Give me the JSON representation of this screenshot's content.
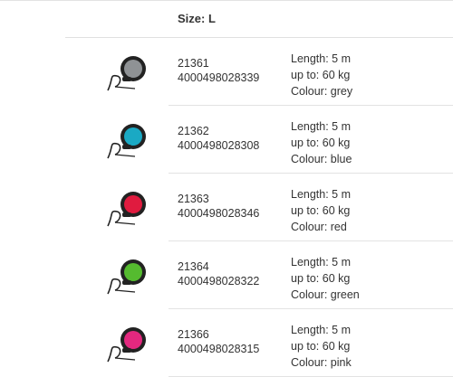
{
  "header": {
    "size_label": "Size: L"
  },
  "products": [
    {
      "article": "21361",
      "ean": "4000498028339",
      "length": "Length: 5 m",
      "weight": "up to: 60 kg",
      "colour_text": "Colour: grey",
      "color": "#8f9295"
    },
    {
      "article": "21362",
      "ean": "4000498028308",
      "length": "Length: 5 m",
      "weight": "up to: 60 kg",
      "colour_text": "Colour: blue",
      "color": "#1aa9c4"
    },
    {
      "article": "21363",
      "ean": "4000498028346",
      "length": "Length: 5 m",
      "weight": "up to: 60 kg",
      "colour_text": "Colour: red",
      "color": "#e01b3f"
    },
    {
      "article": "21364",
      "ean": "4000498028322",
      "length": "Length: 5 m",
      "weight": "up to: 60 kg",
      "colour_text": "Colour: green",
      "color": "#55bb2f"
    },
    {
      "article": "21366",
      "ean": "4000498028315",
      "length": "Length: 5 m",
      "weight": "up to: 60 kg",
      "colour_text": "Colour: pink",
      "color": "#e3287f"
    }
  ]
}
